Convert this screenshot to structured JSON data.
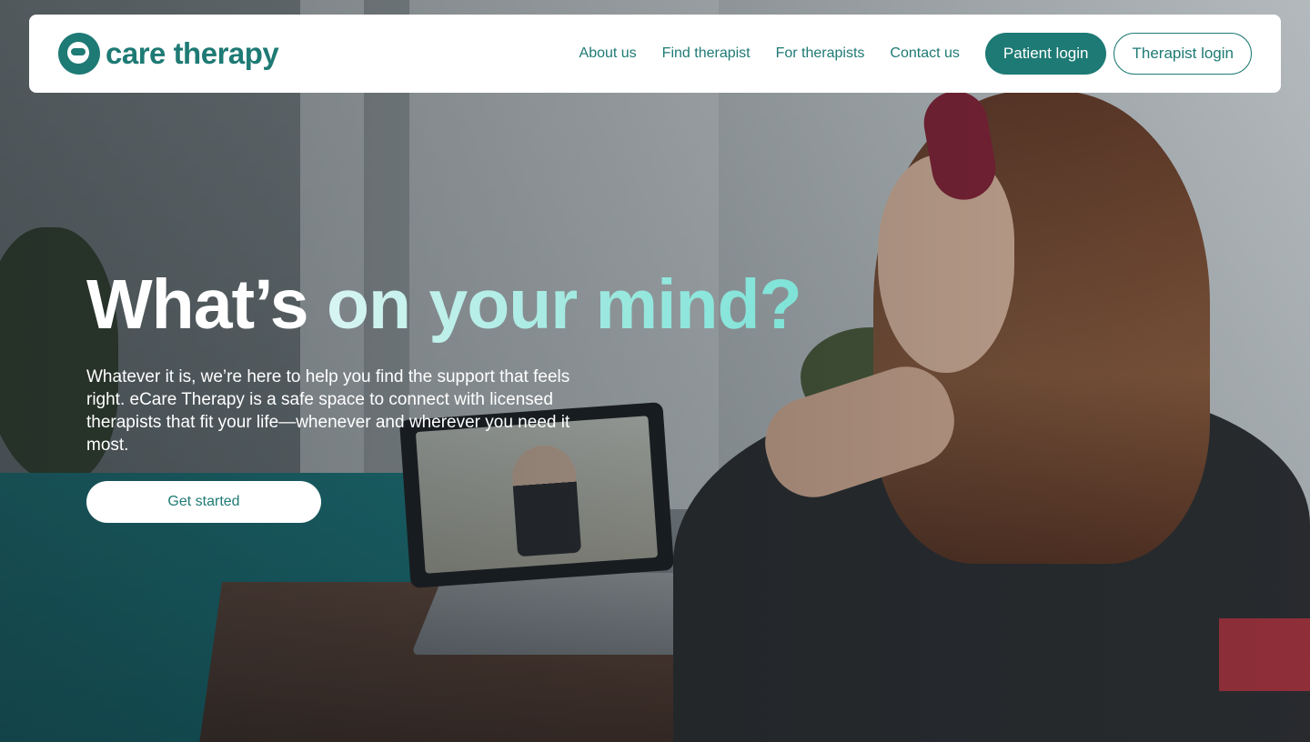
{
  "brand": {
    "name": "care therapy",
    "color": "#1e7a74",
    "icon": "ecare-logo-icon"
  },
  "nav": {
    "links": [
      "About us",
      "Find therapist",
      "For therapists",
      "Contact us"
    ],
    "patient_login": "Patient login",
    "therapist_login": "Therapist login"
  },
  "hero": {
    "headline_white": "What’s",
    "headline_accent": "on your mind?",
    "accent_color": "#9ae8df",
    "subtext": "Whatever it is, we’re here to help you find the support that feels right. eCare Therapy is a safe space to connect with licensed therapists that fit your life—whenever and wherever you need it most.",
    "cta": "Get started"
  }
}
